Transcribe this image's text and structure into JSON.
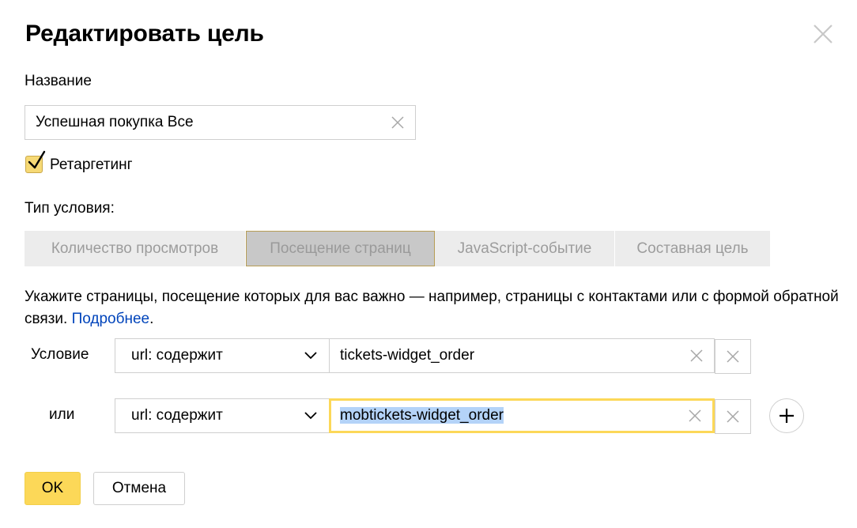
{
  "dialog": {
    "title": "Редактировать цель"
  },
  "name_field": {
    "label": "Название",
    "value": "Успешная покупка Все"
  },
  "retargeting": {
    "label": "Ретаргетинг",
    "checked": true
  },
  "condition_type": {
    "label": "Тип условия:",
    "tabs": [
      {
        "label": "Количество просмотров",
        "active": false
      },
      {
        "label": "Посещение страниц",
        "active": true
      },
      {
        "label": "JavaScript-событие",
        "active": false
      },
      {
        "label": "Составная цель",
        "active": false
      }
    ]
  },
  "description": {
    "text": "Укажите страницы, посещение которых для вас важно — например, страницы с контактами или с формой обратной связи. ",
    "link": "Подробнее",
    "end": "."
  },
  "conditions": [
    {
      "label": "Условие",
      "operator": "url: содержит",
      "value": "tickets-widget_order",
      "focused": false
    },
    {
      "label": "или",
      "operator": "url: содержит",
      "value": "mobtickets-widget_order",
      "focused": true
    }
  ],
  "buttons": {
    "ok": "OK",
    "cancel": "Отмена"
  },
  "icons": {
    "close": "close-icon",
    "clear": "clear-x-icon",
    "chevron": "chevron-down-icon",
    "add": "plus-icon",
    "check": "checkmark-icon"
  },
  "colors": {
    "accent_yellow": "#fcd858",
    "link_blue": "#0044bb",
    "active_tab": "#c8c8c8",
    "selection": "#b4d3f8"
  }
}
